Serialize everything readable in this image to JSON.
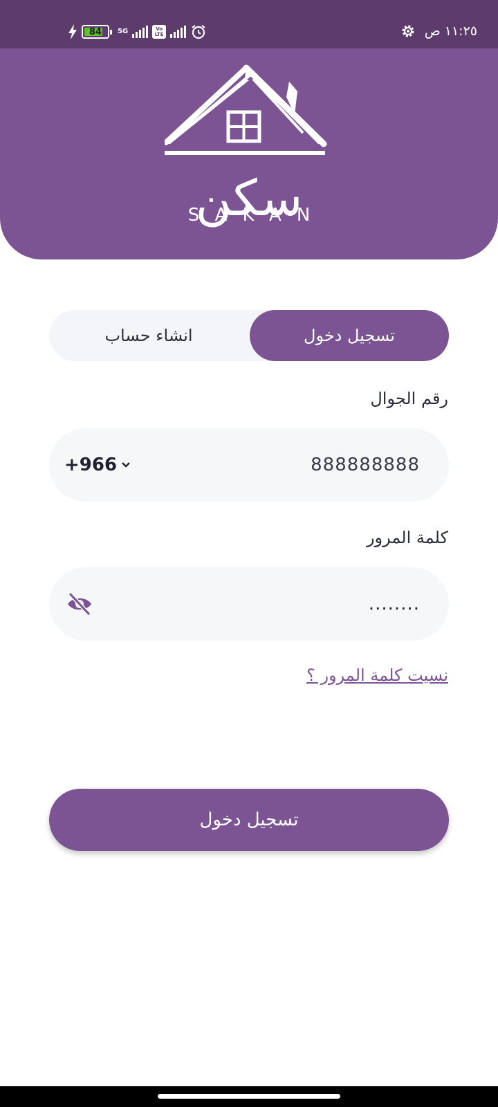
{
  "status_bar": {
    "time": "١١:٢٥ ص",
    "battery_level": 84,
    "battery_text": "84",
    "network_label": "5G",
    "volte_label": "Vo LTE",
    "icons": [
      "charging-bolt-icon",
      "battery-icon",
      "signal-icon",
      "volte-icon",
      "alarm-icon",
      "settings-gear-icon"
    ]
  },
  "brand": {
    "name_ar": "سكن",
    "name_en": "SAKAN",
    "color": "#7c5493"
  },
  "tabs": {
    "login": "تسجيل دخول",
    "register": "انشاء حساب",
    "active": "login"
  },
  "form": {
    "phone_label": "رقم الجوال",
    "phone_value": "888888888",
    "country_code": "+966",
    "password_label": "كلمة المرور",
    "password_value": "........",
    "forgot_password": "نسيت كلمة المرور ؟",
    "submit": "تسجيل دخول"
  }
}
